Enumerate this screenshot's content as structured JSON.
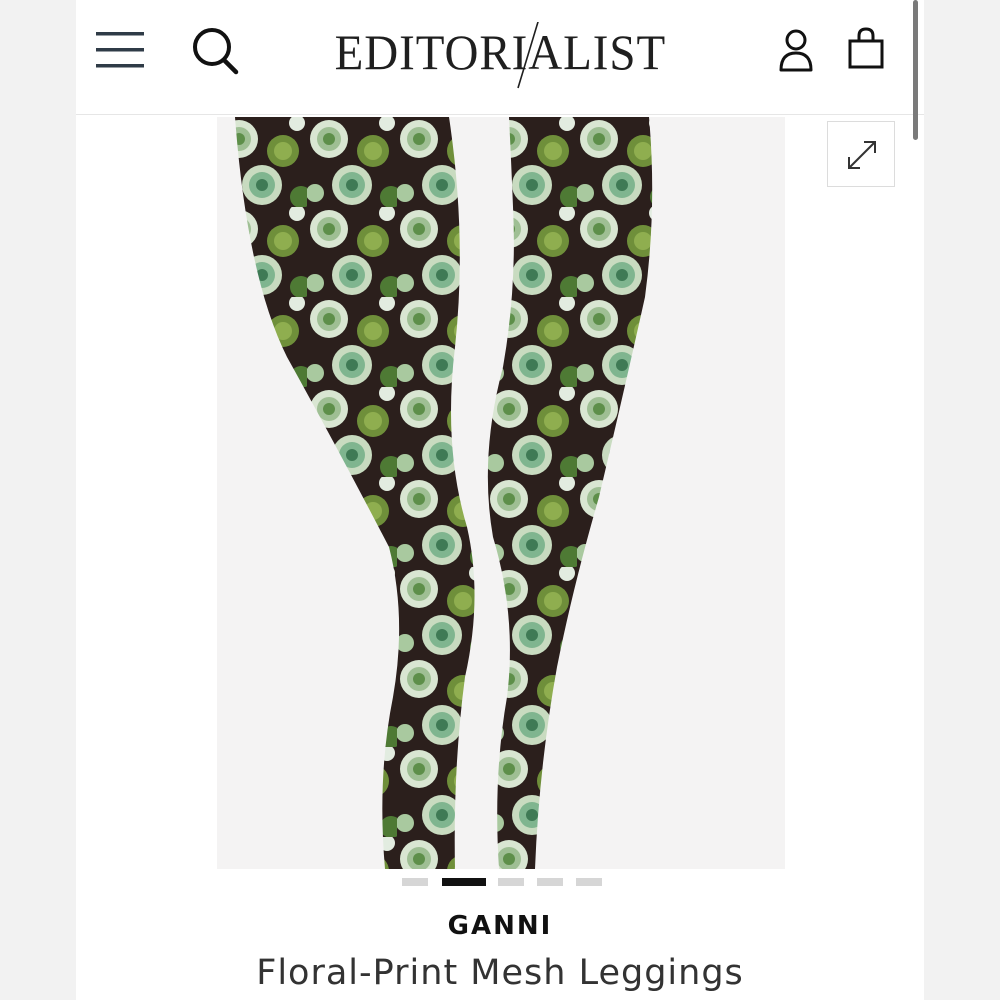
{
  "header": {
    "logo_text": "EDITORIALIST",
    "menu_icon": "hamburger-menu-icon",
    "search_icon": "search-icon",
    "account_icon": "user-icon",
    "bag_icon": "shopping-bag-icon"
  },
  "gallery": {
    "expand_icon": "expand-icon",
    "slide_count": 5,
    "active_slide": 2
  },
  "product": {
    "brand": "GANNI",
    "title": "Floral-Print Mesh Leggings"
  },
  "colors": {
    "text_dark": "#111111",
    "accent_green": "#5e8f4a",
    "print_dark": "#2b1f1c"
  }
}
